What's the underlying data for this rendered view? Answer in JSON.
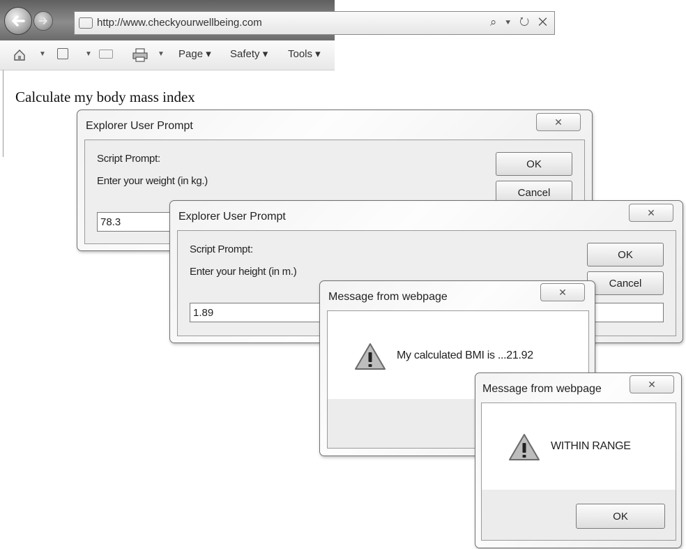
{
  "browser": {
    "url": "http://www.checkyourwellbeing.com",
    "address_tools": "⌕ ▾ ↻ ✕",
    "commands": {
      "page": "Page ▾",
      "safety": "Safety ▾",
      "tools": "Tools ▾"
    },
    "icons": [
      "back-arrow-icon",
      "forward-arrow-icon",
      "home-icon",
      "feeds-icon",
      "mail-icon",
      "print-icon"
    ]
  },
  "page": {
    "heading": "Calculate my body mass index"
  },
  "dialog_weight": {
    "title": "Explorer User Prompt",
    "close": "✕",
    "prompt_label": "Script Prompt:",
    "message": "Enter your weight (in kg.)",
    "value": "78.3",
    "ok": "OK",
    "cancel": "Cancel"
  },
  "dialog_height": {
    "title": "Explorer User Prompt",
    "close": "✕",
    "prompt_label": "Script Prompt:",
    "message": "Enter your height (in m.)",
    "value": "1.89",
    "ok": "OK",
    "cancel": "Cancel"
  },
  "message_bmi": {
    "title": "Message from webpage",
    "close": "✕",
    "text": "My calculated BMI is ...21.92",
    "icon": "warning-icon"
  },
  "message_range": {
    "title": "Message from webpage",
    "close": "✕",
    "text": "WITHIN RANGE",
    "icon": "warning-icon",
    "ok": "OK"
  }
}
